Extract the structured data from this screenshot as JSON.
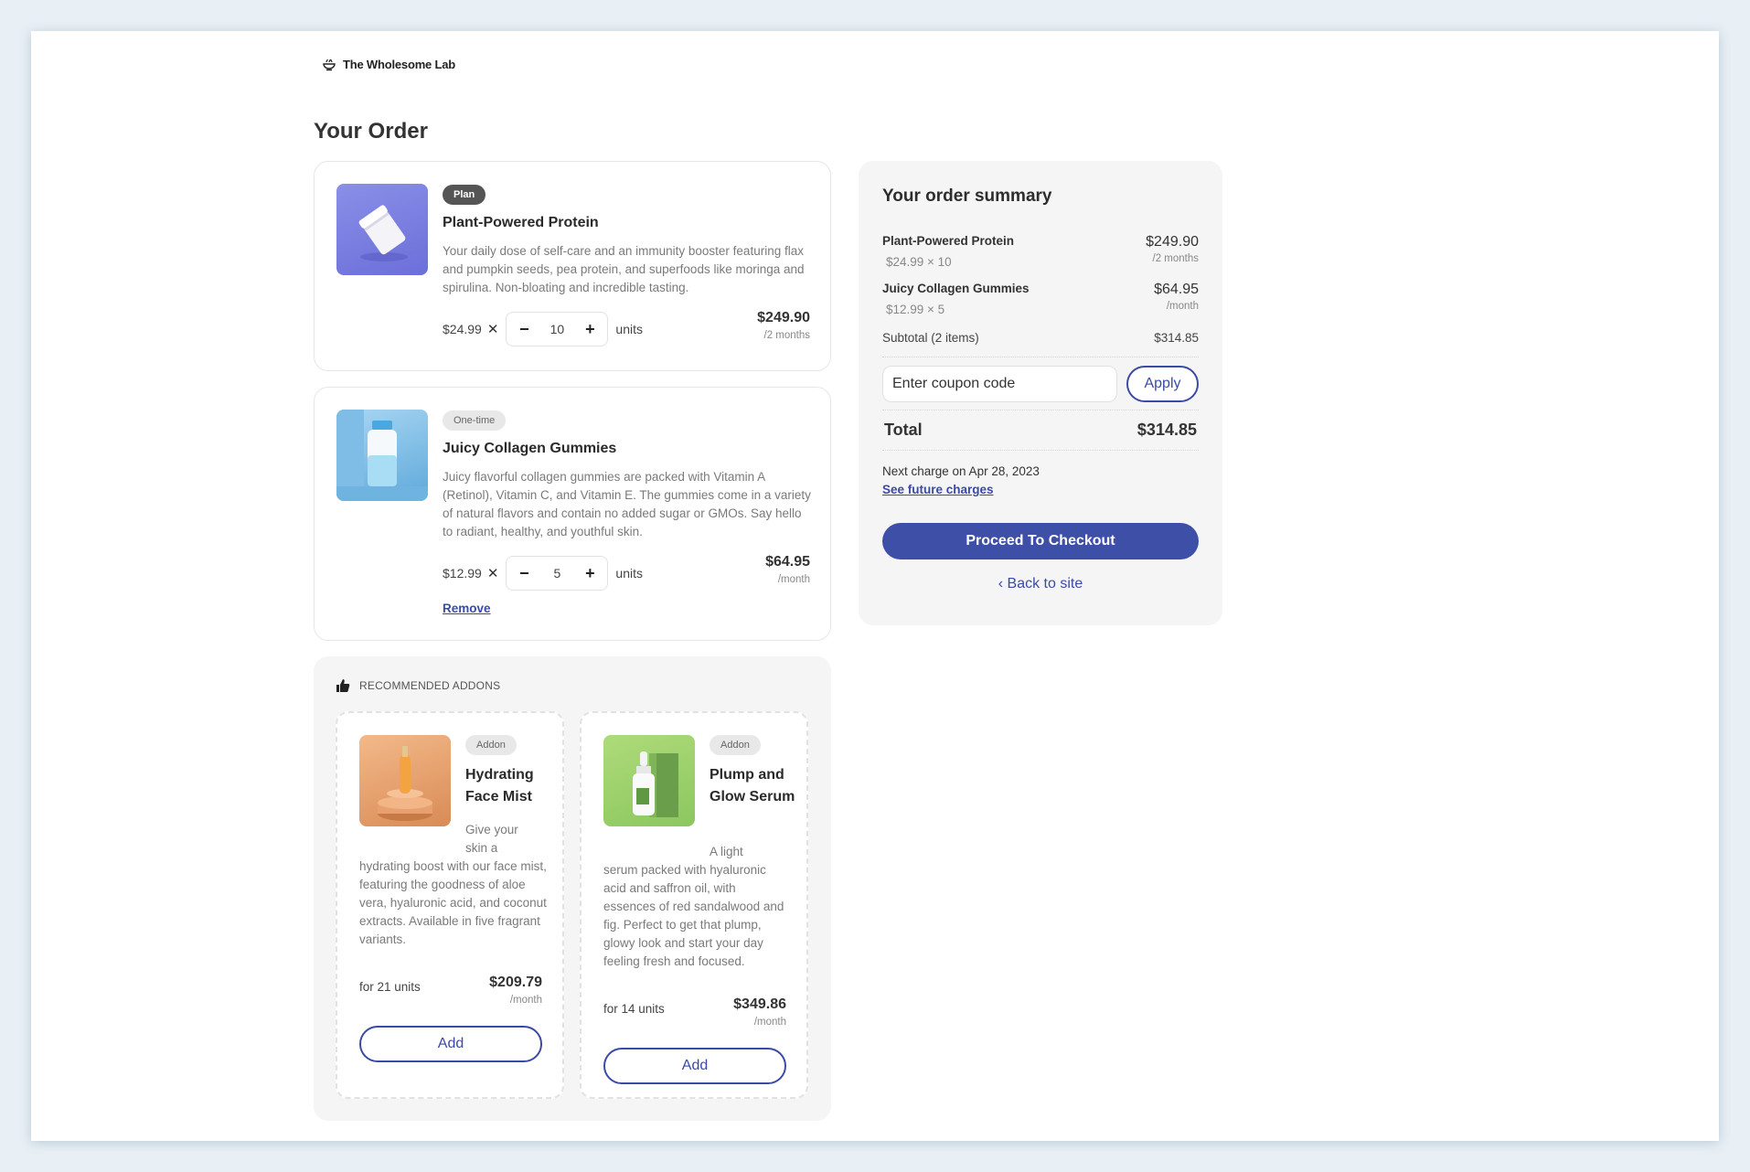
{
  "brand": {
    "name": "The Wholesome Lab",
    "icon": "bowl-icon"
  },
  "page_title": "Your Order",
  "items": [
    {
      "badge": "Plan",
      "name": "Plant-Powered Protein",
      "description": "Your daily dose of self-care and an immunity booster featuring flax and pumpkin seeds, pea protein, and superfoods like moringa and spirulina. Non-bloating and incredible tasting.",
      "unit_price": "$24.99",
      "quantity": "10",
      "units_label": "units",
      "total": "$249.90",
      "period": "/2 months"
    },
    {
      "badge": "One-time",
      "name": "Juicy Collagen Gummies",
      "description": "Juicy flavorful collagen gummies are packed with Vitamin A (Retinol), Vitamin C, and Vitamin E. The gummies come in a variety of natural flavors and contain no added sugar or GMOs. Say hello to radiant, healthy, and youthful skin.",
      "unit_price": "$12.99",
      "quantity": "5",
      "units_label": "units",
      "total": "$64.95",
      "period": "/month",
      "remove_label": "Remove"
    }
  ],
  "addons": {
    "title": "RECOMMENDED ADDONS",
    "items": [
      {
        "badge": "Addon",
        "name": "Hydrating Face Mist",
        "desc_lead": "Give your skin a",
        "desc_rest": "hydrating boost with our face mist, featuring the goodness of aloe vera, hyaluronic acid, and coconut extracts. Available in five fragrant variants.",
        "units": "for 21 units",
        "price": "$209.79",
        "period": "/month",
        "button": "Add"
      },
      {
        "badge": "Addon",
        "name": "Plump and Glow Serum",
        "desc_lead": "A light",
        "desc_rest": "serum packed with hyaluronic acid and saffron oil, with essences of red sandalwood and fig. Perfect to get that plump, glowy look and start your day feeling fresh and focused.",
        "units": "for 14 units",
        "price": "$349.86",
        "period": "/month",
        "button": "Add"
      }
    ]
  },
  "summary": {
    "title": "Your order summary",
    "lines": [
      {
        "name": "Plant-Powered Protein",
        "detail": "$24.99 × 10",
        "price": "$249.90",
        "period": "/2 months"
      },
      {
        "name": "Juicy Collagen Gummies",
        "detail": "$12.99 × 5",
        "price": "$64.95",
        "period": "/month"
      }
    ],
    "subtotal_label": "Subtotal (2 items)",
    "subtotal_value": "$314.85",
    "coupon_placeholder": "Enter coupon code",
    "apply_label": "Apply",
    "total_label": "Total",
    "total_value": "$314.85",
    "next_charge": "Next charge on Apr 28, 2023",
    "future_link": "See future charges",
    "checkout_label": "Proceed To Checkout",
    "back_label": "Back to site"
  },
  "colors": {
    "accent": "#3e4fa8",
    "panel": "#f5f5f5"
  }
}
